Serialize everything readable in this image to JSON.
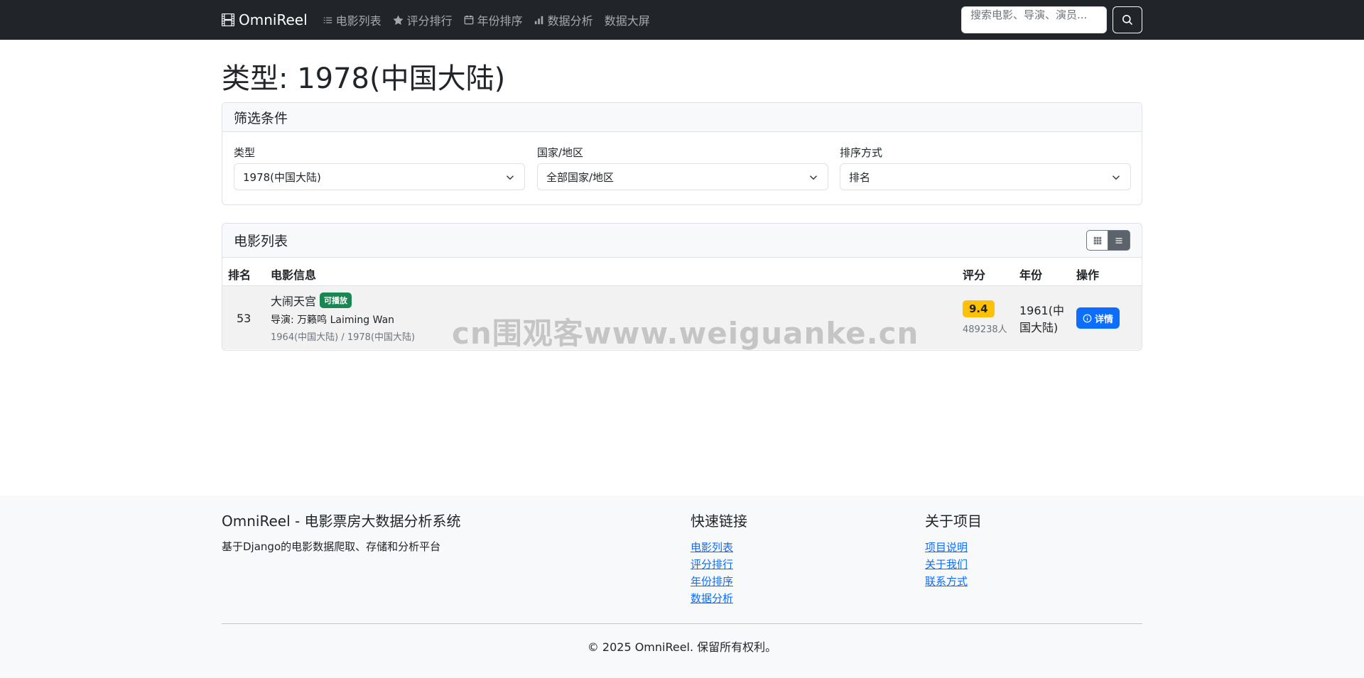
{
  "nav": {
    "brand": "OmniReel",
    "links": [
      "电影列表",
      "评分排行",
      "年份排序",
      "数据分析",
      "数据大屏"
    ],
    "search_placeholder": "搜索电影、导演、演员..."
  },
  "page_title": "类型: 1978(中国大陆)",
  "filter": {
    "header": "筛选条件",
    "genre_label": "类型",
    "genre_value": "1978(中国大陆)",
    "country_label": "国家/地区",
    "country_value": "全部国家/地区",
    "sort_label": "排序方式",
    "sort_value": "排名"
  },
  "list": {
    "header": "电影列表",
    "columns": [
      "排名",
      "电影信息",
      "评分",
      "年份",
      "操作"
    ],
    "rows": [
      {
        "rank": "53",
        "title": "大闹天宫",
        "badge": "可播放",
        "director": "导演: 万籁鸣 Laiming Wan",
        "genres": "1964(中国大陆) / 1978(中国大陆)",
        "rating": "9.4",
        "votes": "489238人",
        "year": "1961(中国大陆)",
        "detail": "详情"
      }
    ]
  },
  "watermark": "cn围观客www.weiguanke.cn",
  "footer": {
    "title": "OmniReel - 电影票房大数据分析系统",
    "subtitle": "基于Django的电影数据爬取、存储和分析平台",
    "quick_links_title": "快速链接",
    "quick_links": [
      "电影列表",
      "评分排行",
      "年份排序",
      "数据分析"
    ],
    "about_title": "关于项目",
    "about_links": [
      "项目说明",
      "关于我们",
      "联系方式"
    ],
    "copyright": "© 2025 OmniReel. 保留所有权利。"
  },
  "colors": {
    "navbar": "#212529",
    "primary": "#0d6efd",
    "success": "#198754",
    "warning": "#ffc107"
  }
}
